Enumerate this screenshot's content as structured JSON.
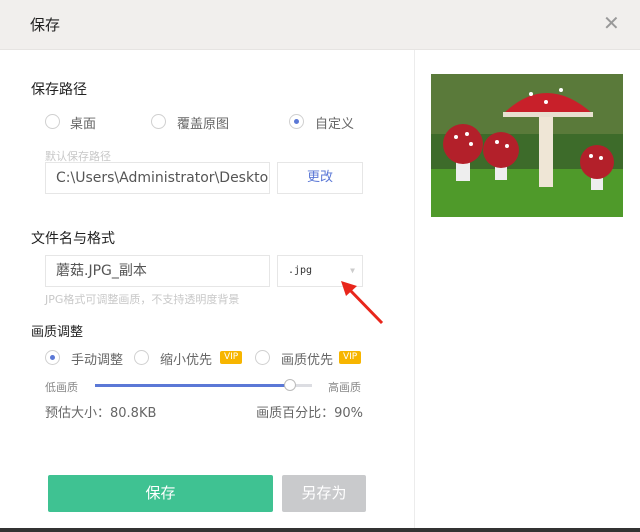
{
  "dialog": {
    "title": "保存",
    "close_icon": "close-icon"
  },
  "save_path": {
    "heading": "保存路径",
    "options": [
      {
        "label": "桌面",
        "selected": false
      },
      {
        "label": "覆盖原图",
        "selected": false
      },
      {
        "label": "自定义",
        "selected": true
      }
    ],
    "default_label": "默认保存路径",
    "path_value": "C:\\Users\\Administrator\\Desktop",
    "change_button": "更改"
  },
  "file": {
    "heading": "文件名与格式",
    "name_value": "蘑菇.JPG_副本",
    "format_value": ".jpg",
    "hint": "JPG格式可调整画质，不支持透明度背景"
  },
  "quality": {
    "heading": "画质调整",
    "options": [
      {
        "label": "手动调整",
        "selected": true
      },
      {
        "label": "缩小优先",
        "selected": false,
        "badge": "VIP"
      },
      {
        "label": "画质优先",
        "selected": false,
        "badge": "VIP"
      }
    ],
    "low_label": "低画质",
    "high_label": "高画质",
    "slider_percent": 90,
    "estimated_size": "预估大小：80.8KB",
    "percent_text": "画质百分比：90%"
  },
  "actions": {
    "save": "保存",
    "save_as": "另存为"
  },
  "colors": {
    "accent": "#5b78d6",
    "primary": "#3fc292",
    "vip": "#f7b500"
  }
}
